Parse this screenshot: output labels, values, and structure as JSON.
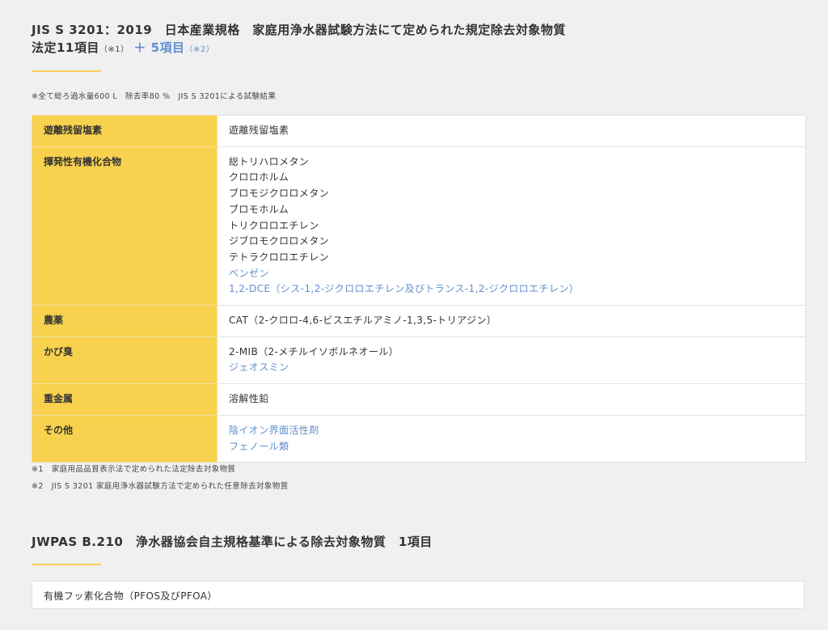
{
  "section1": {
    "title_line1": "JIS S 3201：2019　日本産業規格　家庭用浄水器試験方法にて定められた規定除去対象物質",
    "title_line2_main": "法定11項目",
    "title_line2_note1": "（※1）",
    "title_line2_plus": "＋ 5項目",
    "title_line2_note2": "（※2）",
    "notice": "※全て総ろ過水量600 L　除去率80 %　JIS S 3201による試験結果",
    "rows": [
      {
        "category": "遊離残留塩素",
        "items": [
          {
            "text": "遊離残留塩素",
            "highlight": false
          }
        ]
      },
      {
        "category": "揮発性有機化合物",
        "items": [
          {
            "text": "総トリハロメタン",
            "highlight": false
          },
          {
            "text": "クロロホルム",
            "highlight": false
          },
          {
            "text": "ブロモジクロロメタン",
            "highlight": false
          },
          {
            "text": "ブロモホルム",
            "highlight": false
          },
          {
            "text": "トリクロロエチレン",
            "highlight": false
          },
          {
            "text": "ジブロモクロロメタン",
            "highlight": false
          },
          {
            "text": "テトラクロロエチレン",
            "highlight": false
          },
          {
            "text": "ベンゼン",
            "highlight": true
          },
          {
            "text": "1,2-DCE（シス-1,2-ジクロロエチレン及びトランス-1,2-ジクロロエチレン）",
            "highlight": true
          }
        ]
      },
      {
        "category": "農薬",
        "items": [
          {
            "text": "CAT（2-クロロ-4,6-ビスエチルアミノ-1,3,5-トリアジン）",
            "highlight": false
          }
        ]
      },
      {
        "category": "かび臭",
        "items": [
          {
            "text": "2-MIB（2-メチルイソボルネオール）",
            "highlight": false
          },
          {
            "text": "ジェオスミン",
            "highlight": true
          }
        ]
      },
      {
        "category": "重金属",
        "items": [
          {
            "text": "溶解性鉛",
            "highlight": false
          }
        ]
      },
      {
        "category": "その他",
        "items": [
          {
            "text": "陰イオン界面活性剤",
            "highlight": true
          },
          {
            "text": "フェノール類",
            "highlight": true
          }
        ]
      }
    ],
    "footnotes": [
      "※1　家庭用品品質表示法で定められた法定除去対象物質",
      "※2　JIS S 3201 家庭用浄水器試験方法で定められた任意除去対象物質"
    ]
  },
  "section2": {
    "title": "JWPAS B.210　浄水器協会自主規格基準による除去対象物質　1項目",
    "item": "有機フッ素化合物（PFOS及びPFOA）"
  },
  "colors": {
    "accent_yellow": "#f8d24e",
    "highlight_blue": "#5f8fcf",
    "background": "#f0f0f0"
  }
}
